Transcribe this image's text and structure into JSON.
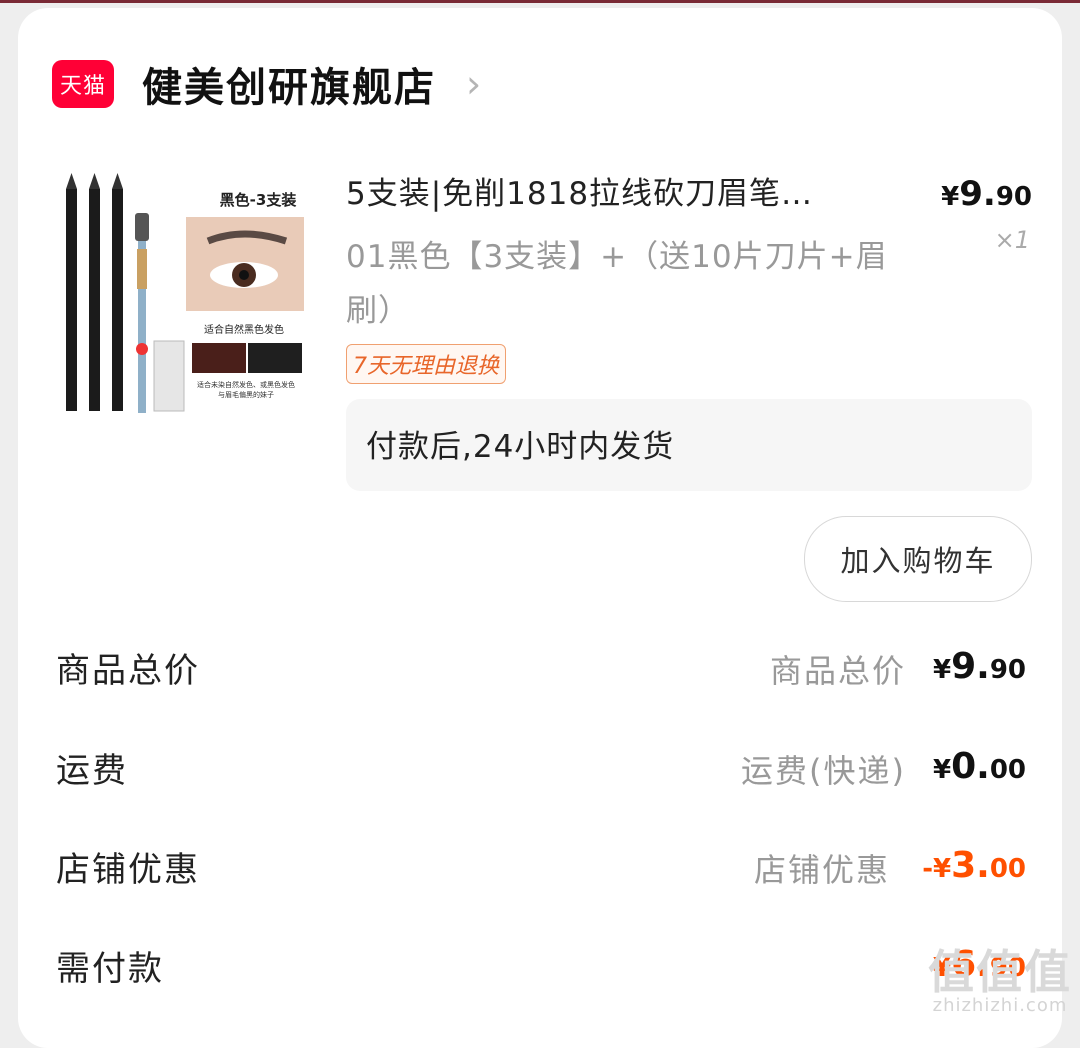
{
  "store": {
    "logo_text": "天猫",
    "name": "健美创研旗舰店",
    "chevron": "›"
  },
  "product": {
    "image": {
      "label": "黑色-3支装",
      "desc1": "适合自然黑色发色",
      "desc2": "适合未染自然发色、或黑色发色",
      "desc3": "与眉毛偏黑的妹子"
    },
    "title": "5支装|免削1818拉线砍刀眉笔…",
    "price_symbol": "¥",
    "price_int": "9.",
    "price_dec": "90",
    "qty": "×1",
    "spec": "01黑色【3支装】+（送10片刀片+眉刷）",
    "return_tag": "7天无理由退换",
    "delivery": "付款后,24小时内发货",
    "cart_button": "加入购物车"
  },
  "summary": {
    "total": {
      "label": "商品总价",
      "sub": "商品总价",
      "symbol": "¥",
      "int": "9.",
      "dec": "90"
    },
    "shipping": {
      "label": "运费",
      "sub": "运费(快递)",
      "symbol": "¥",
      "int": "0.",
      "dec": "00"
    },
    "discount": {
      "label": "店铺优惠",
      "sub": "店铺优惠",
      "symbol": "-¥",
      "int": "3.",
      "dec": "00"
    },
    "pay": {
      "label": "需付款",
      "symbol": "¥",
      "int": "6.",
      "dec": "90"
    }
  },
  "watermark": {
    "big": "值值值",
    "small": "zhizhizhi.com"
  },
  "colors": {
    "tmall_red": "#ff0036",
    "accent_orange": "#ff5000"
  }
}
